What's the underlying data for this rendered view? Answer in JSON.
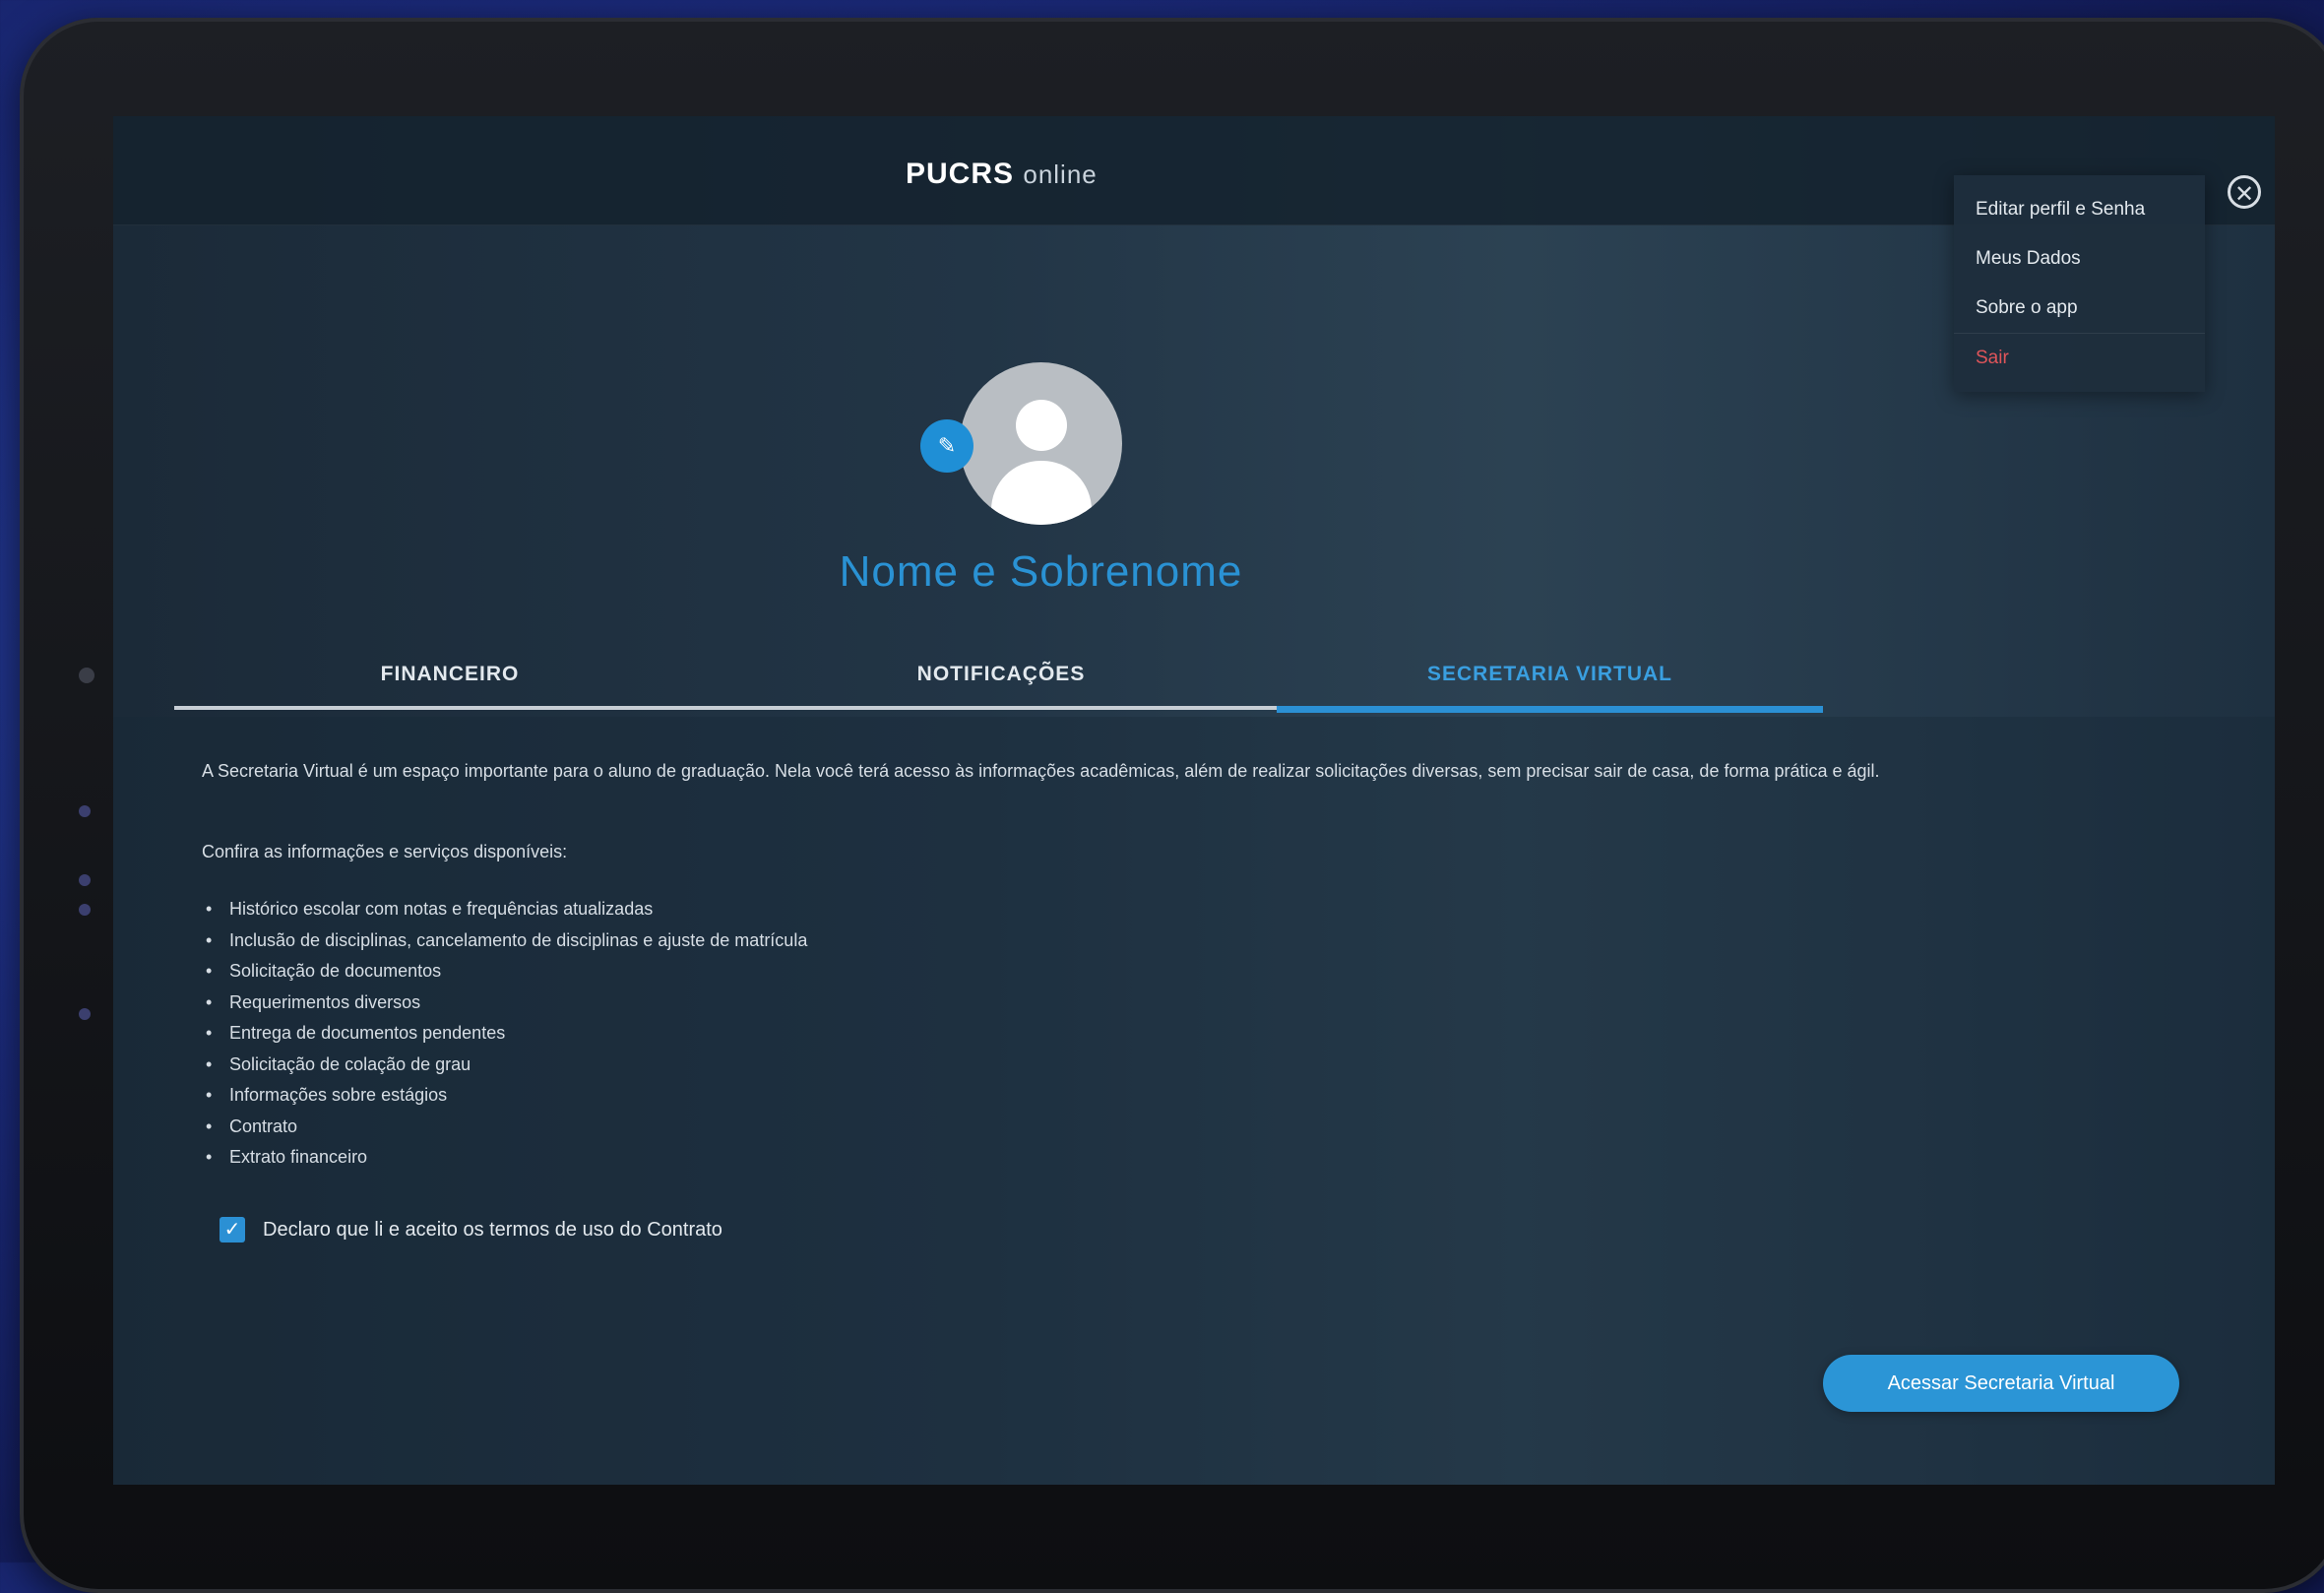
{
  "topbar": {
    "brand_main": "PUCRS",
    "brand_sub": "online"
  },
  "close_icon": "close-circle-icon",
  "menu": {
    "items": [
      {
        "label": "Editar perfil e Senha"
      },
      {
        "label": "Meus Dados"
      },
      {
        "label": "Sobre o app"
      },
      {
        "label": "Sair"
      }
    ]
  },
  "profile": {
    "name": "Nome e Sobrenome",
    "avatar_icon": "user-icon",
    "edit_icon": "pencil-icon"
  },
  "tabs": [
    {
      "label": "FINANCEIRO",
      "active": false
    },
    {
      "label": "NOTIFICAÇÕES",
      "active": false
    },
    {
      "label": "SECRETARIA VIRTUAL",
      "active": true
    }
  ],
  "content": {
    "paragraph1": "A Secretaria Virtual é um espaço importante para o aluno de graduação. Nela você terá acesso às informações acadêmicas, além de realizar solicitações diversas, sem precisar sair de casa, de forma prática e ágil.",
    "paragraph2": "Confira as informações e serviços disponíveis:",
    "features": [
      "Histórico escolar com notas e frequências atualizadas",
      "Inclusão de disciplinas, cancelamento de disciplinas e ajuste de matrícula",
      "Solicitação de documentos",
      "Requerimentos diversos",
      "Entrega de documentos pendentes",
      "Solicitação de colação de grau",
      "Informações sobre estágios",
      "Contrato",
      "Extrato financeiro"
    ],
    "checkbox_label": "Declaro que li e aceito os termos de uso do Contrato",
    "checkbox_checked": true
  },
  "cta": {
    "label": "Acessar Secretaria Virtual"
  },
  "colors": {
    "accent": "#2b90d4",
    "danger": "#e0555a",
    "background": "#1f3344"
  }
}
